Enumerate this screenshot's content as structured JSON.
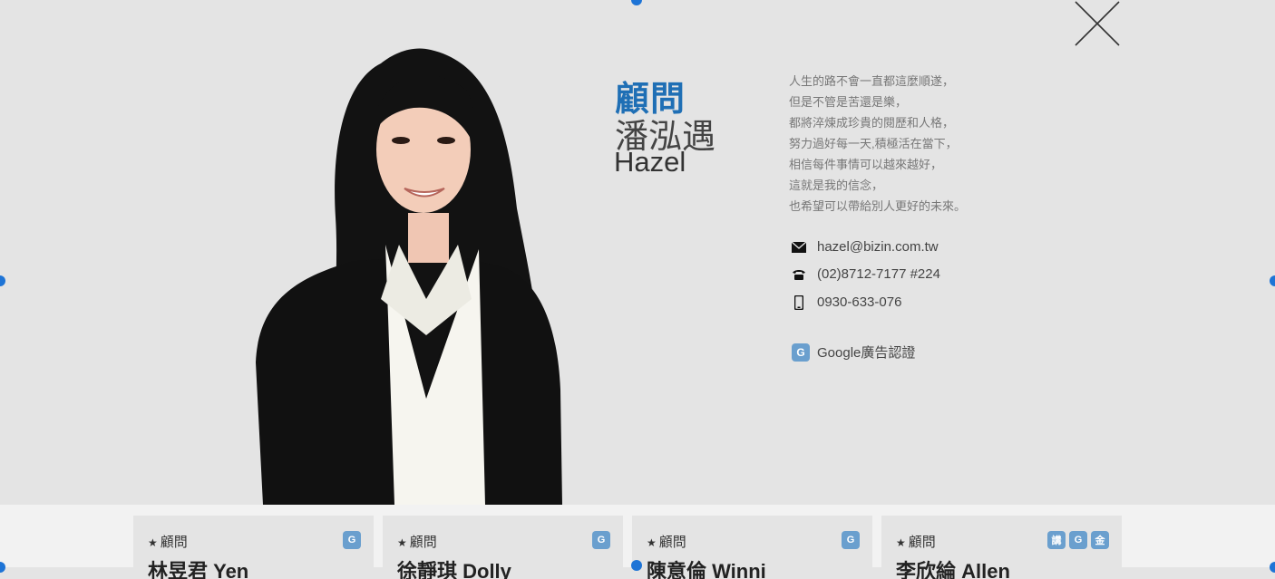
{
  "profile": {
    "role": "顧問",
    "name_zh": "潘泓遇",
    "name_en": "Hazel",
    "quote": [
      "人生的路不會一直都這麼順遂，",
      "但是不管是苦還是樂，",
      "都將淬煉成珍貴的閱歷和人格，",
      "努力過好每一天,積極活在當下，",
      "相信每件事情可以越來越好，",
      "這就是我的信念，",
      "也希望可以帶給別人更好的未來。"
    ],
    "email": "hazel@bizin.com.tw",
    "phone": "(02)8712-7177 #224",
    "mobile": "0930-633-076",
    "certification": {
      "badge": "G",
      "label": "Google廣告認證"
    }
  },
  "cards": [
    {
      "star": "★",
      "role": "顧問",
      "name": "林昱君 Yen",
      "badges": [
        "G"
      ]
    },
    {
      "star": "★",
      "role": "顧問",
      "name": "徐靜琪 Dolly",
      "badges": [
        "G"
      ]
    },
    {
      "star": "★",
      "role": "顧問",
      "name": "陳意倫 Winni",
      "badges": [
        "G"
      ]
    },
    {
      "star": "★",
      "role": "顧問",
      "name": "李欣綸 Allen",
      "badges": [
        "講",
        "G",
        "金"
      ]
    }
  ],
  "colors": {
    "accent": "#1f6fb5",
    "badge": "#6a9fce",
    "background": "#e4e4e4",
    "handle": "#1e74d6"
  },
  "icons": {
    "close": "close-icon",
    "email": "envelope-icon",
    "phone": "telephone-icon",
    "mobile": "mobile-phone-icon"
  }
}
